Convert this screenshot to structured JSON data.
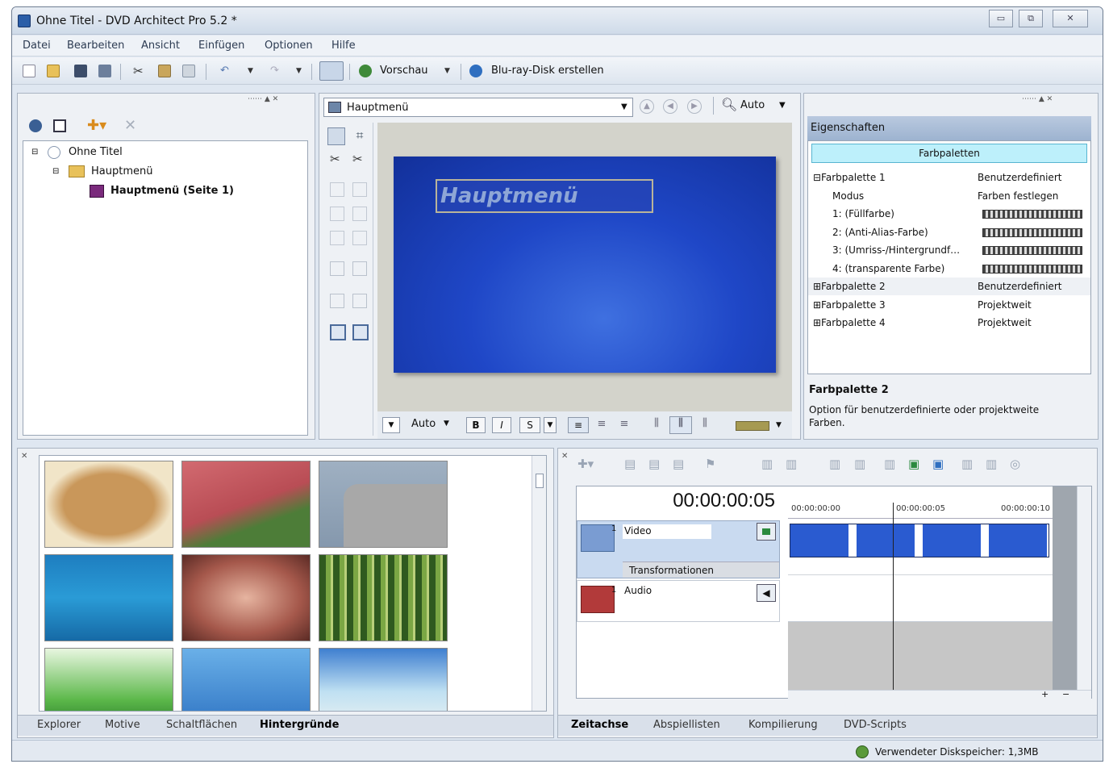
{
  "window": {
    "title": "Ohne Titel - DVD Architect Pro 5.2 *",
    "controls": [
      "▭",
      "⧉",
      "✕"
    ]
  },
  "menu": [
    "Datei",
    "Bearbeiten",
    "Ansicht",
    "Einfügen",
    "Optionen",
    "Hilfe"
  ],
  "toolbar": {
    "preview_label": "Vorschau",
    "bluray_label": "Blu-ray-Disk erstellen"
  },
  "project_tree": {
    "root": "Ohne Titel",
    "menu": "Hauptmenü",
    "page": "Hauptmenü (Seite 1)"
  },
  "editor": {
    "menu_select": "Hauptmenü",
    "zoom": "Auto",
    "canvas_text": "Hauptmenü",
    "font_size": "Auto",
    "bold": "B",
    "italic": "I",
    "shadow": "S"
  },
  "properties": {
    "header": "Eigenschaften",
    "category_button": "Farbpaletten",
    "rows": [
      {
        "key": "⊟Farbpalette 1",
        "value": "Benutzerdefiniert"
      },
      {
        "key": "Modus",
        "value": "Farben festlegen"
      },
      {
        "key": "1: (Füllfarbe)",
        "value": ""
      },
      {
        "key": "2: (Anti-Alias-Farbe)",
        "value": ""
      },
      {
        "key": "3: (Umriss-/Hintergrundf…",
        "value": ""
      },
      {
        "key": "4: (transparente Farbe)",
        "value": ""
      },
      {
        "key": "⊞Farbpalette 2",
        "value": "Benutzerdefiniert"
      },
      {
        "key": "⊞Farbpalette 3",
        "value": "Projektweit"
      },
      {
        "key": "⊞Farbpalette 4",
        "value": "Projektweit"
      }
    ],
    "desc_title": "Farbpalette 2",
    "desc_text": "Option für benutzerdefinierte oder projektweite Farben."
  },
  "media_tabs": [
    "Explorer",
    "Motive",
    "Schaltflächen",
    "Hintergründe"
  ],
  "timeline": {
    "timecode": "00:00:00:05",
    "ruler": [
      "00:00:00:00",
      "00:00:00:05",
      "00:00:00:10"
    ],
    "video_track": "Video",
    "transform_label": "Transformationen",
    "audio_track": "Audio",
    "track_number": "1"
  },
  "timeline_tabs": [
    "Zeitachse",
    "Abspiellisten",
    "Kompilierung",
    "DVD-Scripts"
  ],
  "status": {
    "disk_usage": "Verwendeter Diskspeicher: 1,3MB"
  }
}
